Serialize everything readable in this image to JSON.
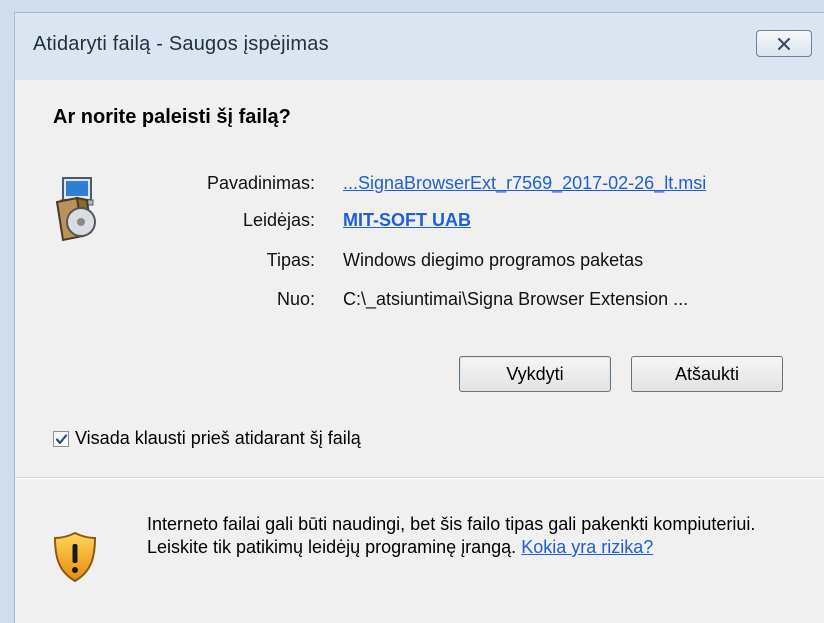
{
  "window": {
    "title": "Atidaryti failą - Saugos įspėjimas"
  },
  "dialog": {
    "question": "Ar norite paleisti šį failą?",
    "properties": [
      {
        "label": "Pavadinimas:",
        "value": "...SignaBrowserExt_r7569_2017-02-26_lt.msi",
        "style": "link"
      },
      {
        "label": "Leidėjas:",
        "value": "MIT-SOFT UAB",
        "style": "link-bold"
      },
      {
        "label": "Tipas:",
        "value": "Windows diegimo programos paketas",
        "style": "plain"
      },
      {
        "label": "Nuo:",
        "value": "C:\\_atsiuntimai\\Signa Browser Extension ...",
        "style": "plain"
      }
    ],
    "buttons": {
      "run": "Vykdyti",
      "cancel": "Atšaukti"
    },
    "checkbox": {
      "label": "Visada klausti prieš atidarant šį failą",
      "checked": true
    },
    "warning": {
      "text": "Interneto failai gali būti naudingi, bet šis failo tipas gali pakenkti kompiuteriui. Leiskite tik patikimų leidėjų programinę įrangą.",
      "link": "Kokia yra rizika?"
    }
  },
  "icons": {
    "installer": "msi-installer-icon",
    "warning": "warning-shield-icon",
    "close": "close-icon",
    "check": "check-icon"
  }
}
